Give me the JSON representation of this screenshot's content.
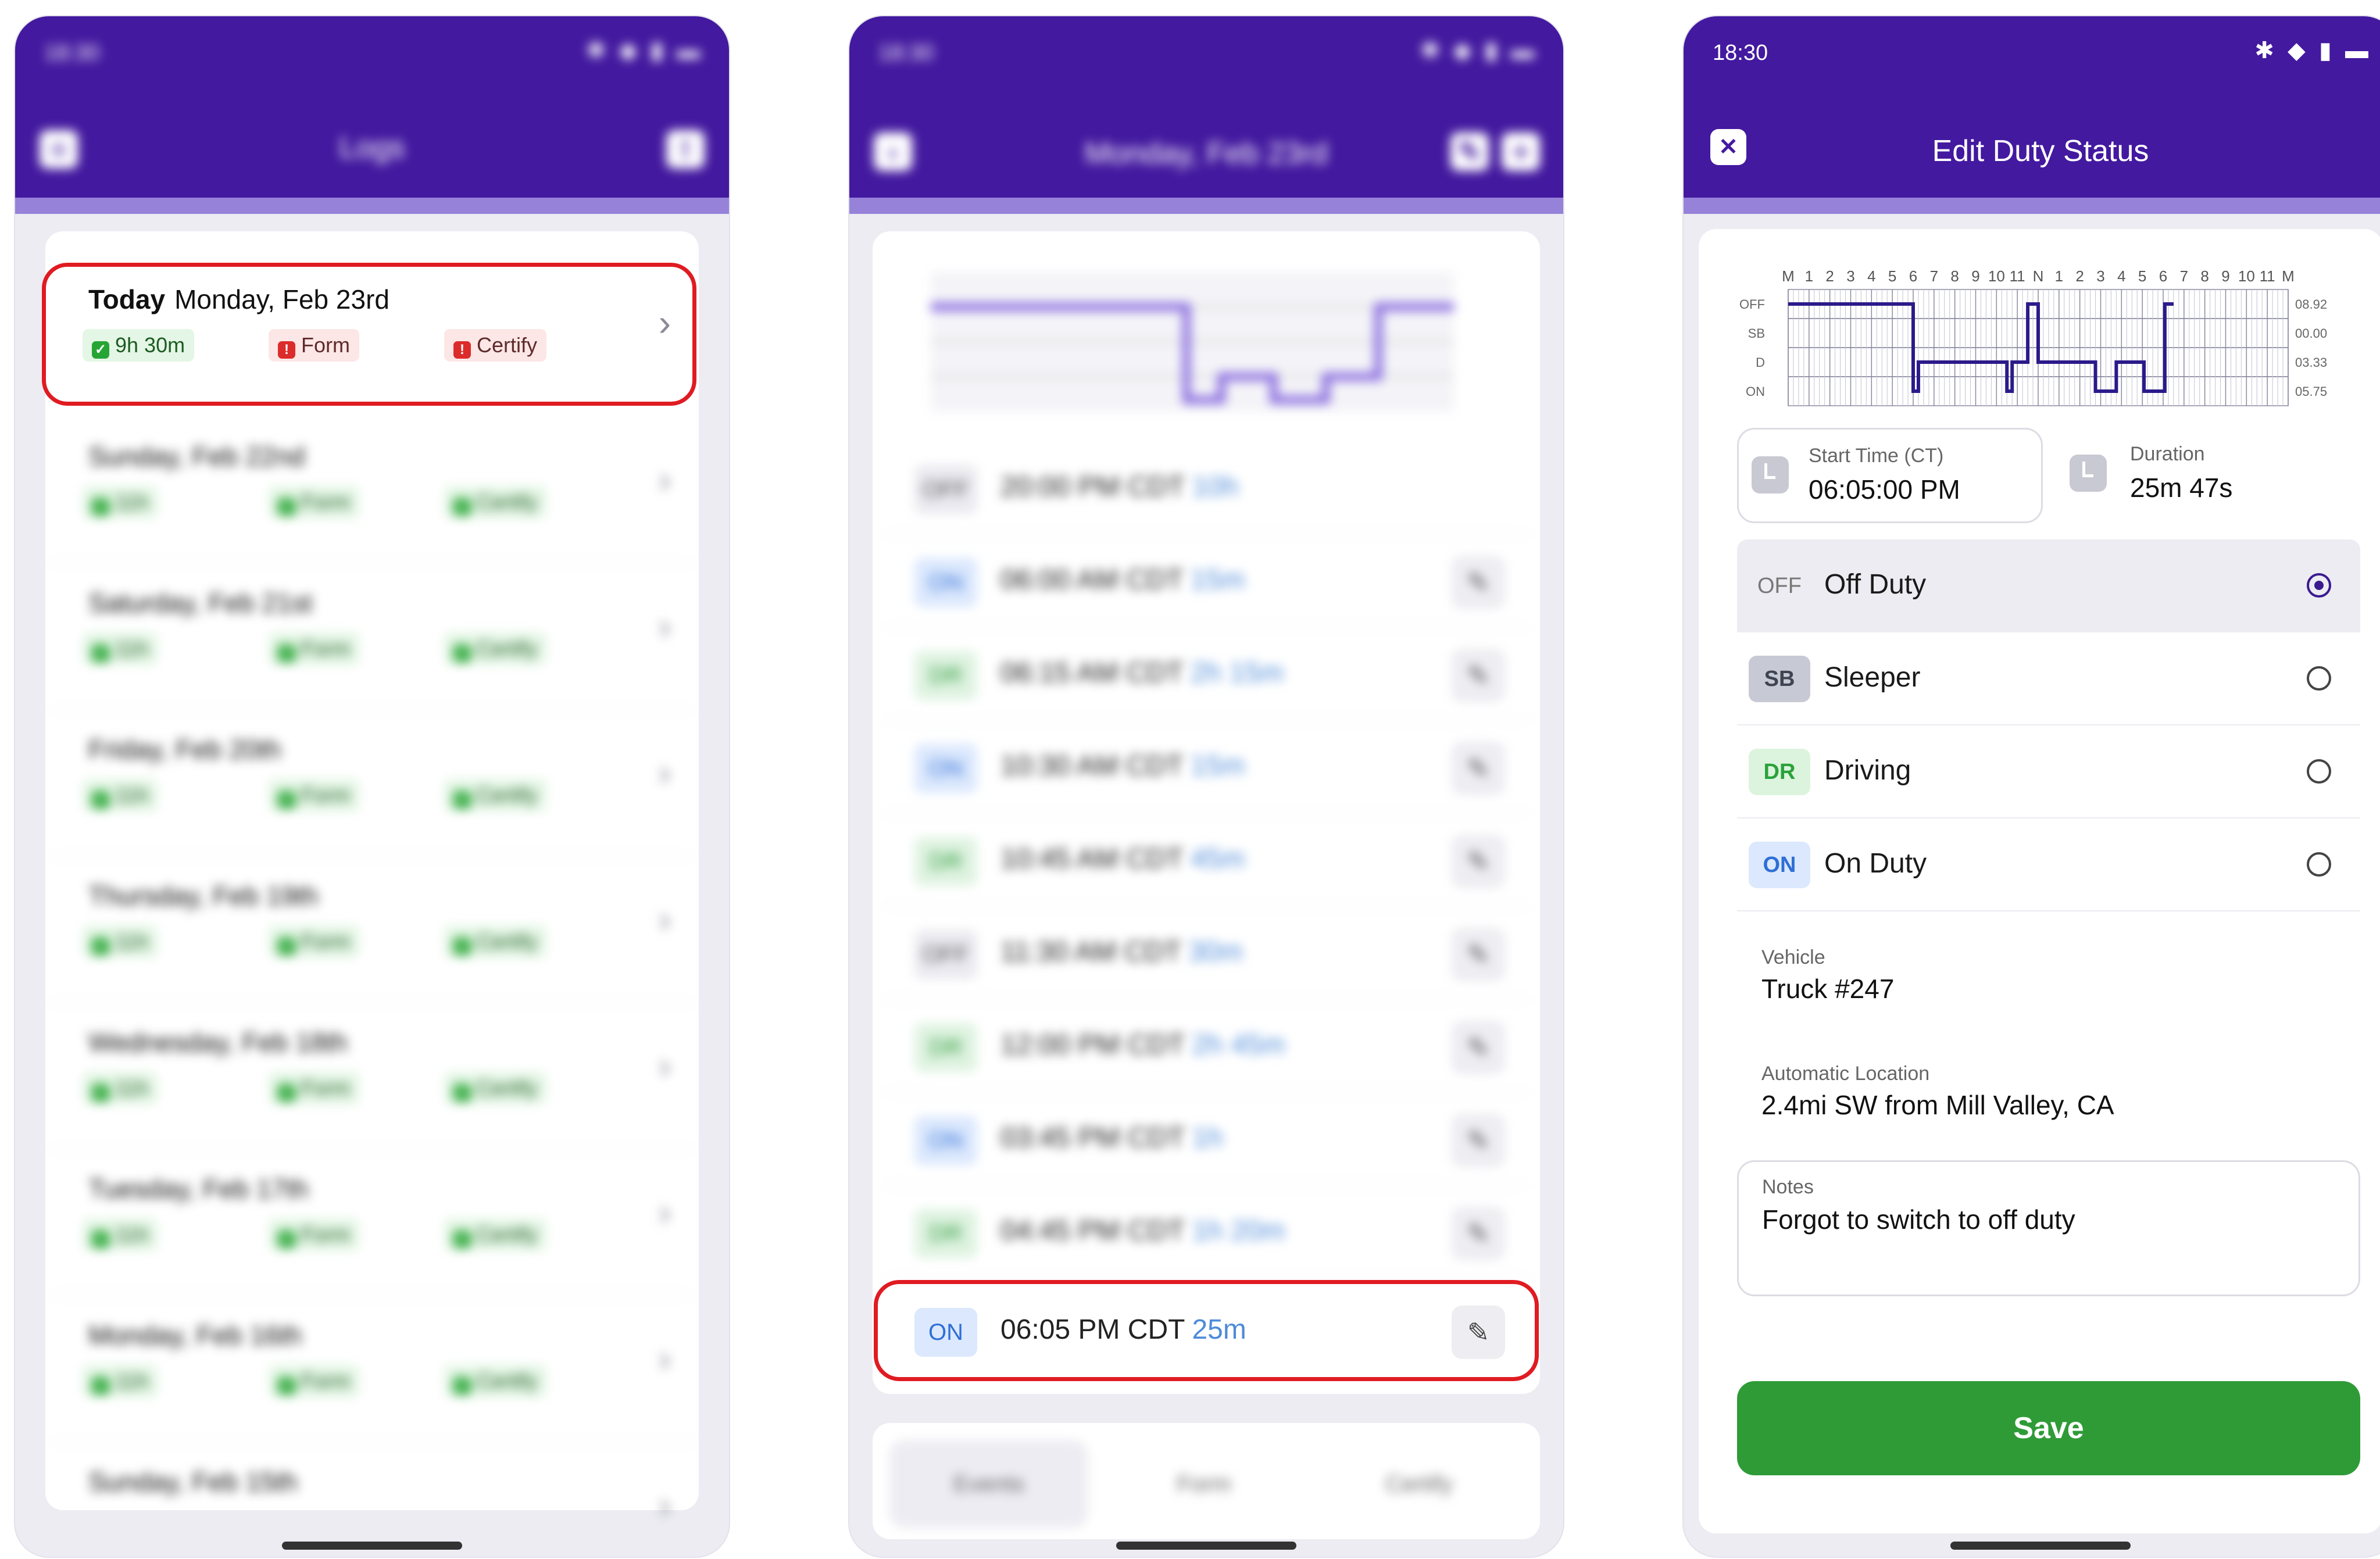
{
  "colors": {
    "header": "#43199f",
    "highlight": "#e01b22",
    "save": "#2f9b37",
    "on_duty": "#2f6fd6",
    "driving": "#2aa23a"
  },
  "phone1": {
    "status_time": "18:30",
    "title": "Logs",
    "today": {
      "label": "Today",
      "date": "Monday, Feb 23rd",
      "hours": "9h 30m",
      "form": "Form",
      "certify": "Certify"
    },
    "days": [
      {
        "date": "Sunday, Feb 22nd",
        "hours": "11h",
        "form": "Form",
        "certify": "Certify"
      },
      {
        "date": "Saturday, Feb 21st",
        "hours": "11h",
        "form": "Form",
        "certify": "Certify"
      },
      {
        "date": "Friday, Feb 20th",
        "hours": "11h",
        "form": "Form",
        "certify": "Certify"
      },
      {
        "date": "Thursday, Feb 19th",
        "hours": "11h",
        "form": "Form",
        "certify": "Certify"
      },
      {
        "date": "Wednesday, Feb 18th",
        "hours": "11h",
        "form": "Form",
        "certify": "Certify"
      },
      {
        "date": "Tuesday, Feb 17th",
        "hours": "11h",
        "form": "Form",
        "certify": "Certify"
      },
      {
        "date": "Monday, Feb 16th",
        "hours": "11h",
        "form": "Form",
        "certify": "Certify"
      },
      {
        "date": "Sunday, Feb 15th",
        "hours": "11h",
        "form": "Form",
        "certify": "Certify"
      }
    ]
  },
  "phone2": {
    "status_time": "18:30",
    "title": "Monday, Feb 23rd",
    "events": [
      {
        "status": "OFF",
        "time": "20:00 PM CDT",
        "dur": "10h"
      },
      {
        "status": "ON",
        "time": "06:00 AM CDT",
        "dur": "15m"
      },
      {
        "status": "DR",
        "time": "06:15 AM CDT",
        "dur": "2h 15m"
      },
      {
        "status": "ON",
        "time": "10:30 AM CDT",
        "dur": "15m"
      },
      {
        "status": "DR",
        "time": "10:45 AM CDT",
        "dur": "45m"
      },
      {
        "status": "OFF",
        "time": "11:30 AM CDT",
        "dur": "30m"
      },
      {
        "status": "DR",
        "time": "12:00 PM CDT",
        "dur": "2h 45m"
      },
      {
        "status": "ON",
        "time": "03:45 PM CDT",
        "dur": "1h"
      },
      {
        "status": "DR",
        "time": "04:45 PM CDT",
        "dur": "1h 20m"
      }
    ],
    "highlight_event": {
      "status": "ON",
      "time": "06:05 PM CDT",
      "dur": "25m"
    },
    "tabs": [
      "Events",
      "Form",
      "Certify"
    ]
  },
  "phone3": {
    "status_time": "18:30",
    "title": "Edit Duty Status",
    "graph": {
      "hour_labels": [
        "M",
        "1",
        "2",
        "3",
        "4",
        "5",
        "6",
        "7",
        "8",
        "9",
        "10",
        "11",
        "N",
        "1",
        "2",
        "3",
        "4",
        "5",
        "6",
        "7",
        "8",
        "9",
        "10",
        "11",
        "M"
      ],
      "rows": [
        "OFF",
        "SB",
        "D",
        "ON"
      ],
      "totals": [
        "08.92",
        "00.00",
        "03.33",
        "05.75"
      ]
    },
    "start_time": {
      "label": "Start Time (CT)",
      "value": "06:05:00 PM"
    },
    "duration": {
      "label": "Duration",
      "value": "25m 47s"
    },
    "statuses": [
      {
        "code": "OFF",
        "label": "Off Duty",
        "selected": true
      },
      {
        "code": "SB",
        "label": "Sleeper",
        "selected": false
      },
      {
        "code": "DR",
        "label": "Driving",
        "selected": false
      },
      {
        "code": "ON",
        "label": "On Duty",
        "selected": false
      }
    ],
    "vehicle": {
      "label": "Vehicle",
      "value": "Truck #247"
    },
    "location": {
      "label": "Automatic Location",
      "value": "2.4mi SW from Mill Valley, CA"
    },
    "notes": {
      "label": "Notes",
      "value": "Forgot to switch to off duty"
    },
    "save_label": "Save"
  }
}
